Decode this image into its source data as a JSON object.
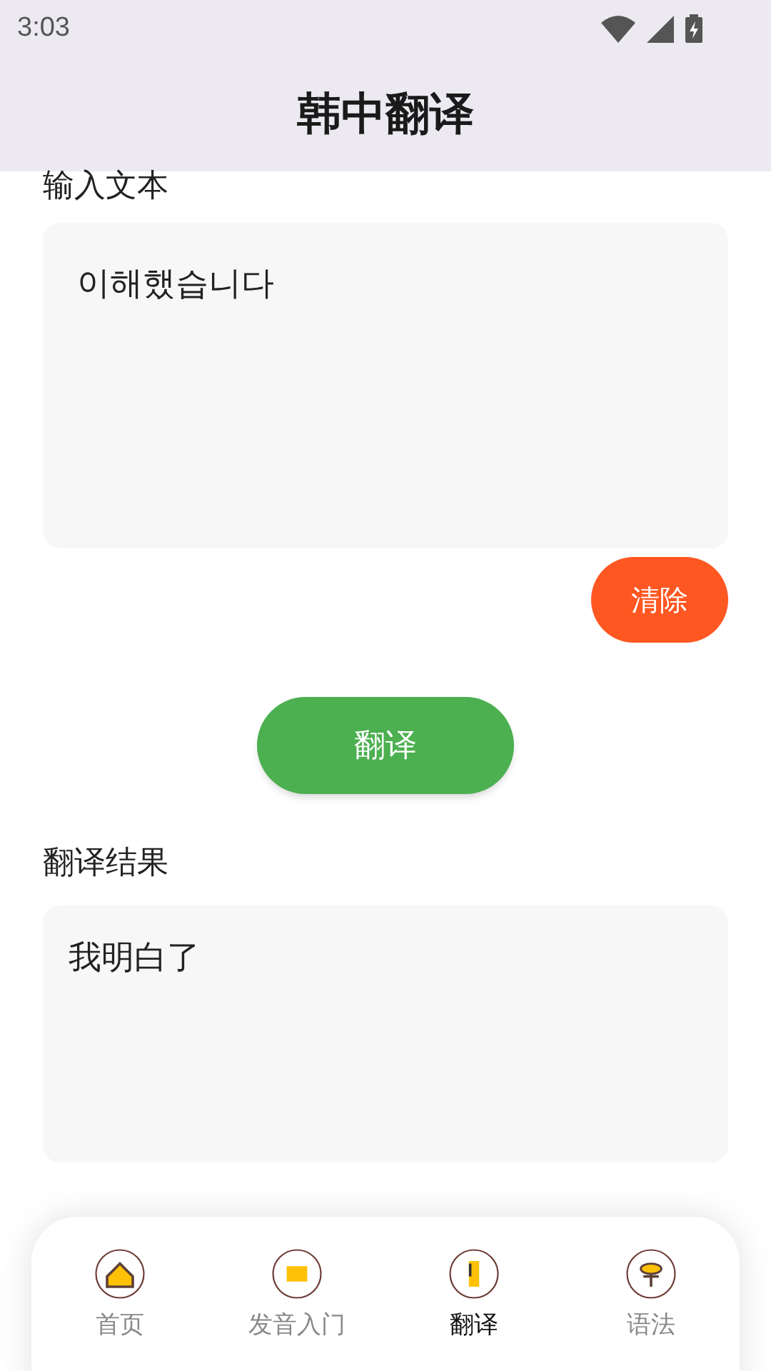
{
  "status_bar": {
    "time": "3:03"
  },
  "app_bar": {
    "title": "韩中翻译"
  },
  "input": {
    "label": "输入文本",
    "value": "이해했습니다"
  },
  "clear_button": "清除",
  "translate_button": "翻译",
  "result": {
    "label": "翻译结果",
    "value": "我明白了"
  },
  "bottom_nav": [
    {
      "label": "首页",
      "selected": false
    },
    {
      "label": "发音入门",
      "selected": false
    },
    {
      "label": "翻译",
      "selected": true
    },
    {
      "label": "语法",
      "selected": false
    }
  ]
}
